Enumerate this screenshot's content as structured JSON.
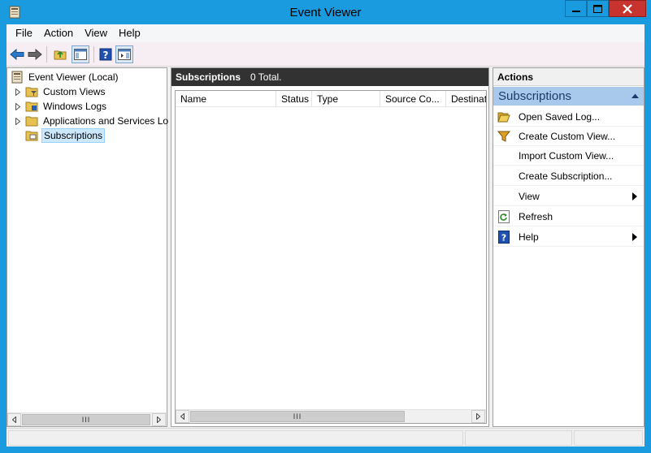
{
  "window": {
    "title": "Event Viewer"
  },
  "menu": [
    "File",
    "Action",
    "View",
    "Help"
  ],
  "tree": {
    "root": "Event Viewer (Local)",
    "items": [
      {
        "label": "Custom Views",
        "icon": "folder-filter-icon"
      },
      {
        "label": "Windows Logs",
        "icon": "folder-log-icon"
      },
      {
        "label": "Applications and Services Lo",
        "icon": "folder-icon"
      },
      {
        "label": "Subscriptions",
        "icon": "subscriptions-icon",
        "selected": true
      }
    ]
  },
  "middle": {
    "title": "Subscriptions",
    "count": "0 Total.",
    "columns": [
      "Name",
      "Status",
      "Type",
      "Source Co...",
      "Destinat"
    ]
  },
  "actions": {
    "header": "Actions",
    "section": "Subscriptions",
    "items": [
      {
        "label": "Open Saved Log...",
        "icon": "open-folder-icon"
      },
      {
        "label": "Create Custom View...",
        "icon": "filter-icon"
      },
      {
        "label": "Import Custom View...",
        "icon": ""
      },
      {
        "label": "Create Subscription...",
        "icon": ""
      },
      {
        "label": "View",
        "icon": "",
        "submenu": true
      },
      {
        "label": "Refresh",
        "icon": "refresh-icon"
      },
      {
        "label": "Help",
        "icon": "help-icon",
        "submenu": true
      }
    ]
  },
  "scrollbar_thumb": "III",
  "colors": {
    "titlebar": "#1a9be0",
    "close": "#c7332e",
    "section": "#a9c9ec",
    "header_dark": "#323232"
  }
}
